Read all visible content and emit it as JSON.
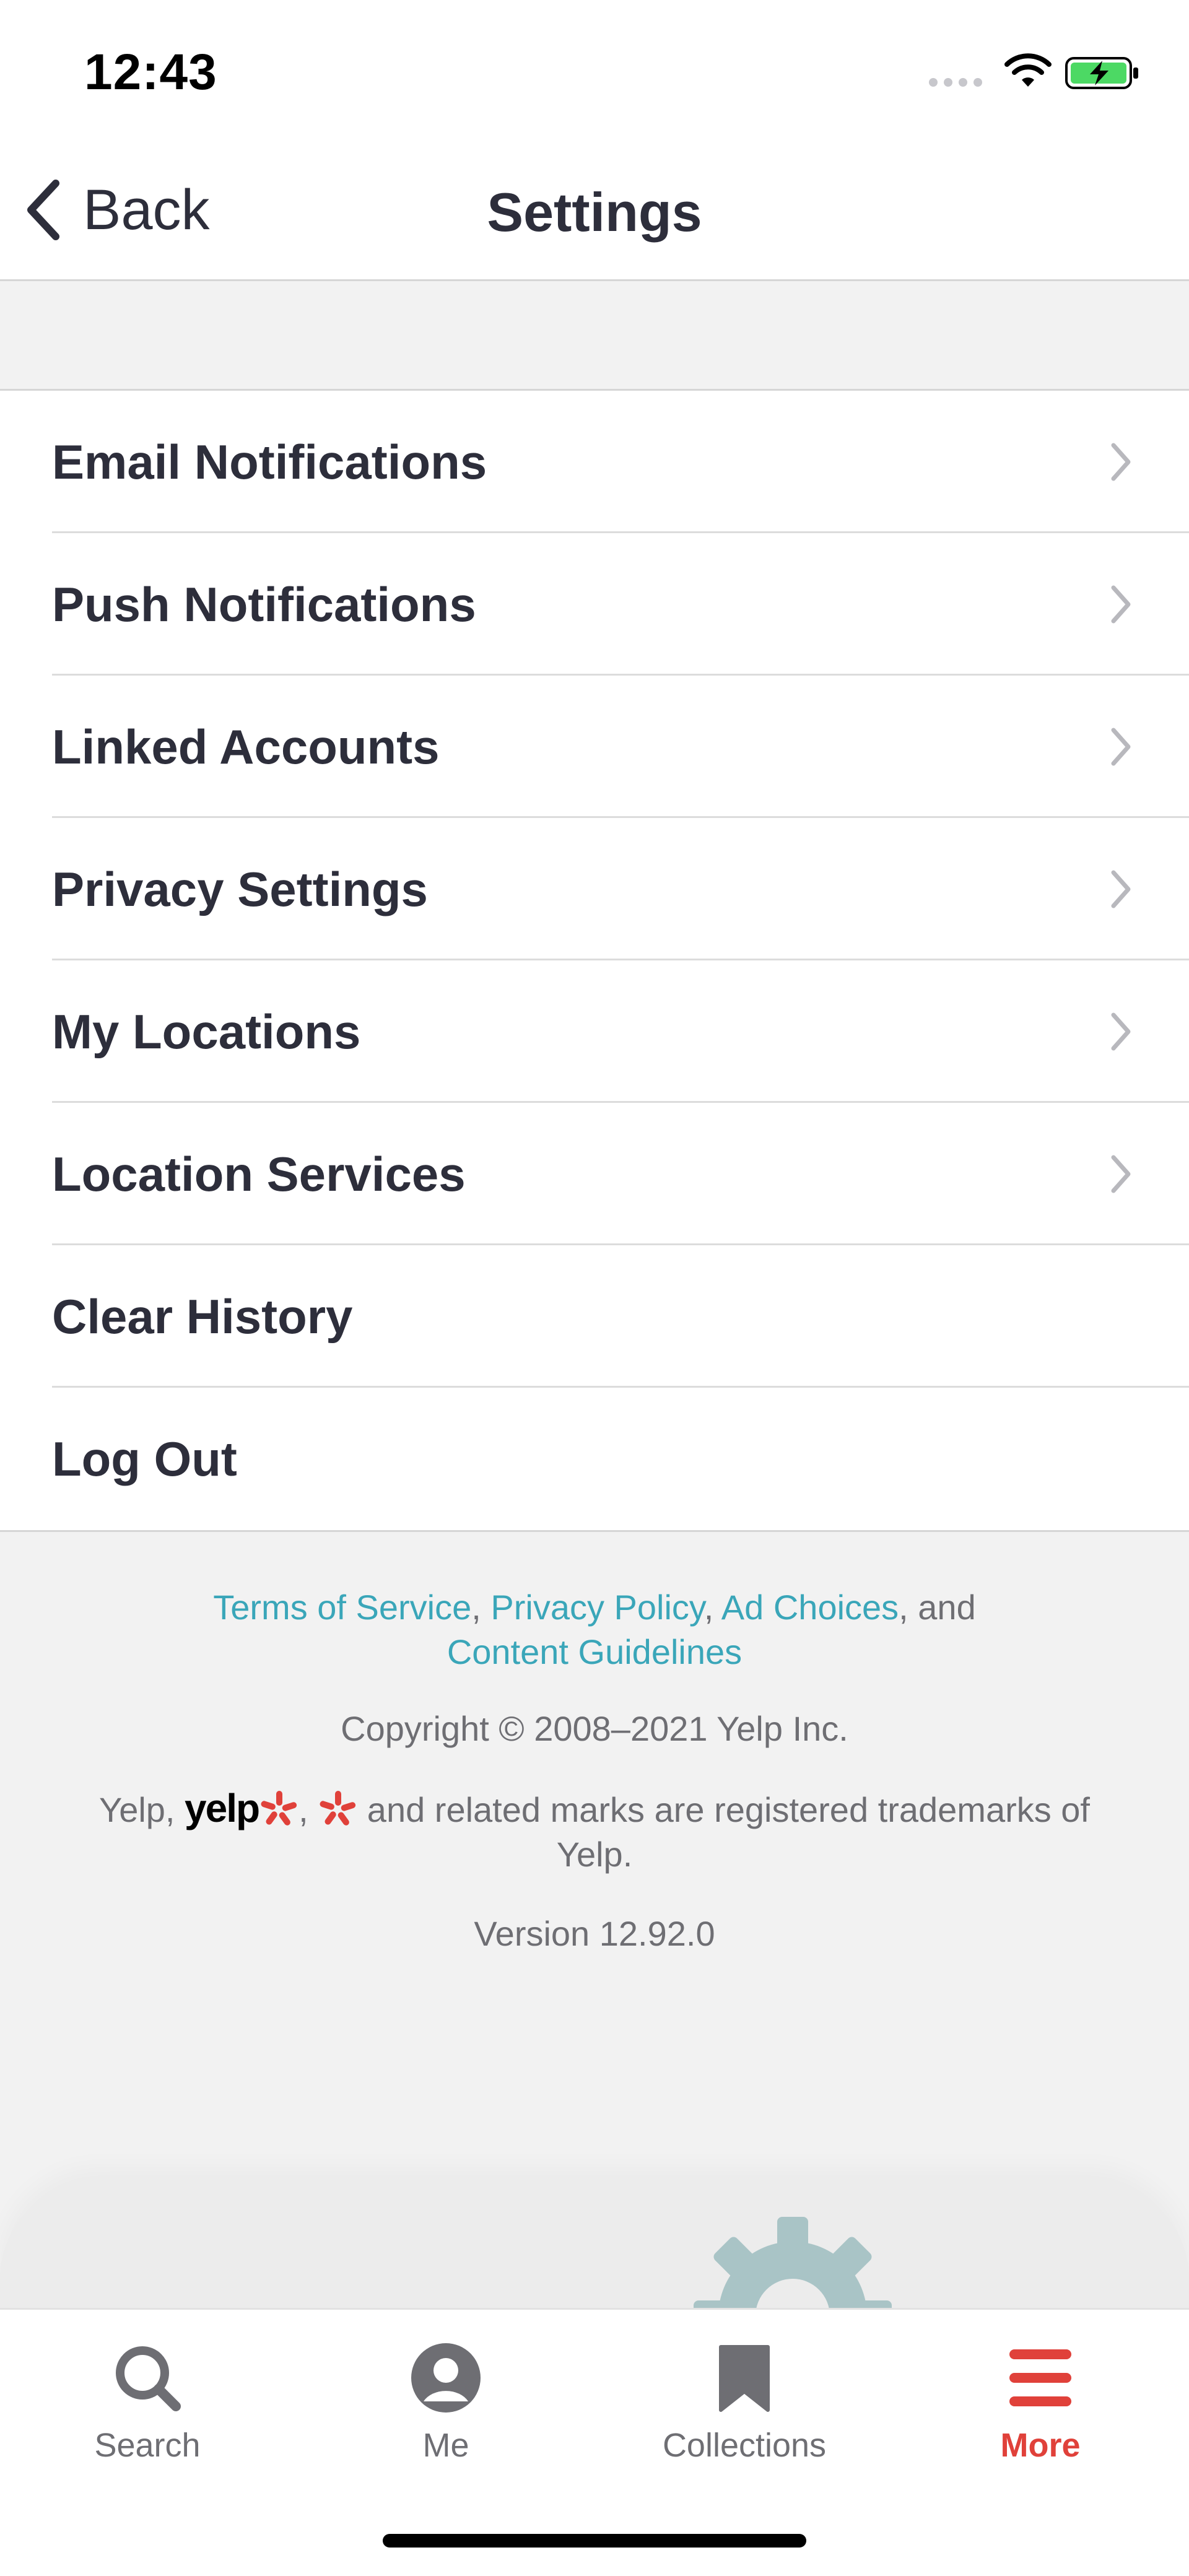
{
  "status_bar": {
    "time": "12:43"
  },
  "nav": {
    "back_label": "Back",
    "title": "Settings"
  },
  "settings": {
    "items": [
      {
        "label": "Email Notifications",
        "has_chevron": true
      },
      {
        "label": "Push Notifications",
        "has_chevron": true
      },
      {
        "label": "Linked Accounts",
        "has_chevron": true
      },
      {
        "label": "Privacy Settings",
        "has_chevron": true
      },
      {
        "label": "My Locations",
        "has_chevron": true
      },
      {
        "label": "Location Services",
        "has_chevron": true
      },
      {
        "label": "Clear History",
        "has_chevron": false
      },
      {
        "label": "Log Out",
        "has_chevron": false
      }
    ]
  },
  "footer": {
    "links": [
      "Terms of Service",
      "Privacy Policy",
      "Ad Choices",
      "Content Guidelines"
    ],
    "sep_comma": ",",
    "sep_and": ", and",
    "copyright": "Copyright © 2008–2021 Yelp Inc.",
    "trademark_prefix": "Yelp,",
    "yelp_wordmark": "yelp",
    "trademark_suffix": "and related marks are registered trademarks of Yelp.",
    "version": "Version 12.92.0"
  },
  "tab_bar": {
    "tabs": [
      {
        "label": "Search",
        "icon": "search-icon",
        "active": false
      },
      {
        "label": "Me",
        "icon": "profile-icon",
        "active": false
      },
      {
        "label": "Collections",
        "icon": "bookmark-icon",
        "active": false
      },
      {
        "label": "More",
        "icon": "menu-icon",
        "active": true
      }
    ]
  },
  "colors": {
    "accent_red": "#e0413a",
    "link_teal": "#3aa6b9",
    "text_dark": "#2d2e3b",
    "background_gray": "#f2f2f2"
  }
}
